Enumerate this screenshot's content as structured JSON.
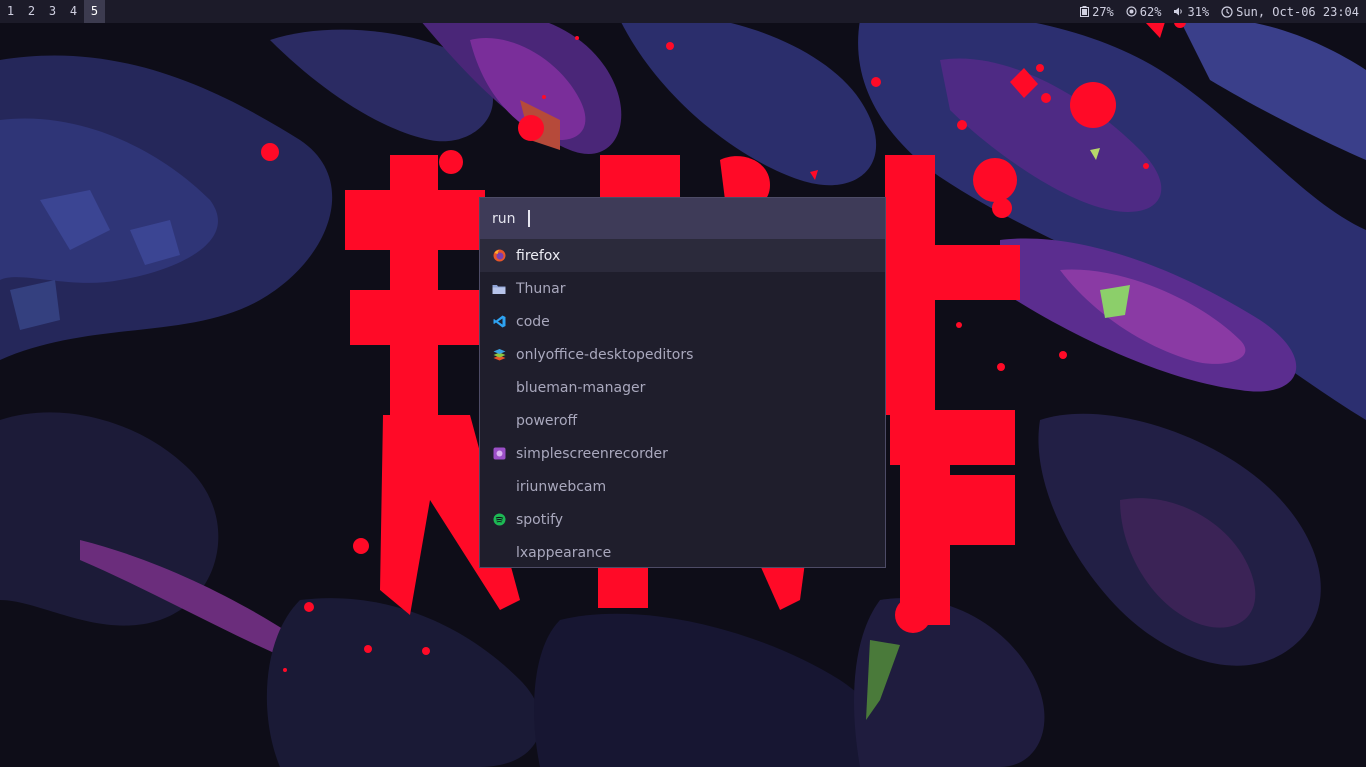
{
  "bar": {
    "workspaces": [
      {
        "label": "1"
      },
      {
        "label": "2"
      },
      {
        "label": "3"
      },
      {
        "label": "4"
      },
      {
        "label": "5"
      }
    ],
    "active_workspace": "5",
    "battery": {
      "icon": "battery-icon",
      "value": "27%"
    },
    "cpu": {
      "icon": "cpu-icon",
      "value": "62%"
    },
    "volume": {
      "icon": "volume-icon",
      "value": "31%"
    },
    "clock": {
      "icon": "clock-icon",
      "value": "Sun, Oct-06 23:04"
    }
  },
  "launcher": {
    "prompt": "run",
    "input_value": "",
    "entries": [
      {
        "label": "firefox",
        "icon": "firefox-icon"
      },
      {
        "label": "Thunar",
        "icon": "folder-icon"
      },
      {
        "label": "code",
        "icon": "vscode-icon"
      },
      {
        "label": "onlyoffice-desktopeditors",
        "icon": "onlyoffice-icon"
      },
      {
        "label": "blueman-manager",
        "icon": ""
      },
      {
        "label": "poweroff",
        "icon": ""
      },
      {
        "label": "simplescreenrecorder",
        "icon": "screen-recorder-icon"
      },
      {
        "label": "iriunwebcam",
        "icon": ""
      },
      {
        "label": "spotify",
        "icon": "spotify-icon"
      },
      {
        "label": "lxappearance",
        "icon": ""
      }
    ],
    "selected_index": 0
  },
  "colors": {
    "bar_bg": "#1c1b29",
    "launcher_bg": "#1f1e2c",
    "prompt_bg": "#3e3b58",
    "selected_bg": "#2b2a3b",
    "wallpaper_accent": "#ff0a27"
  }
}
